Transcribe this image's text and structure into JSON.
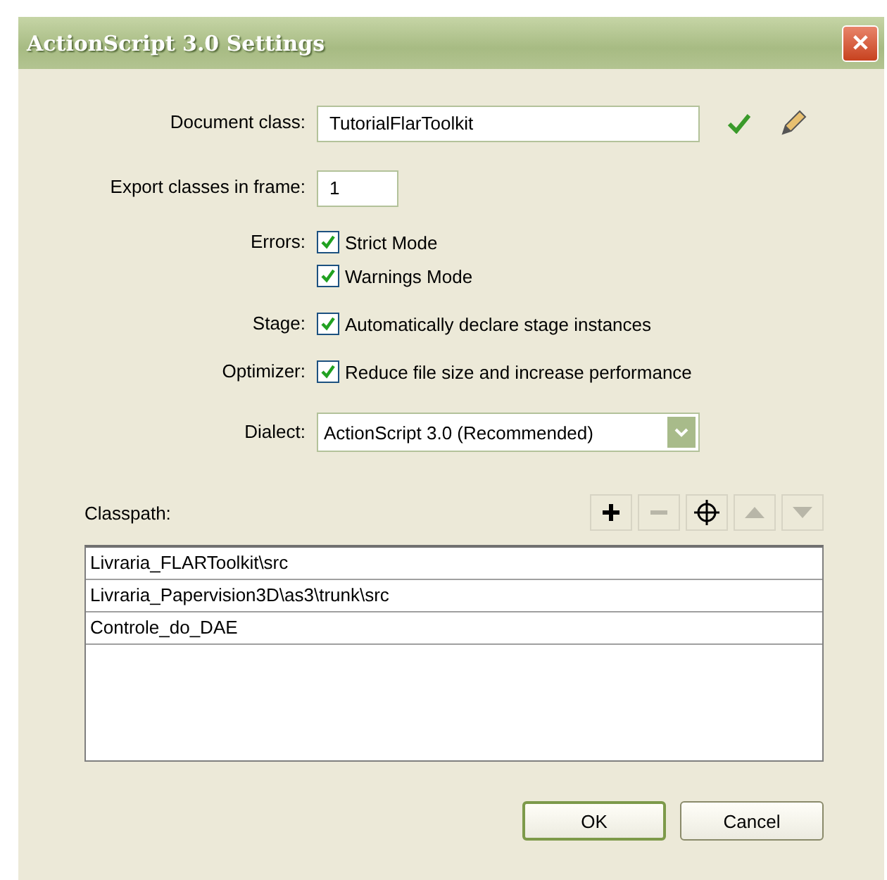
{
  "window": {
    "title": "ActionScript 3.0 Settings",
    "close": "✕"
  },
  "document_class": {
    "label": "Document class:",
    "value": "TutorialFlarToolkit"
  },
  "export_frame": {
    "label": "Export classes in frame:",
    "value": "1"
  },
  "options": [
    {
      "label": "Errors:",
      "checkboxes": [
        {
          "text": "Strict Mode",
          "checked": true
        },
        {
          "text": "Warnings Mode",
          "checked": true
        }
      ]
    },
    {
      "label": "Stage:",
      "checkboxes": [
        {
          "text": "Automatically declare stage instances",
          "checked": true
        }
      ]
    },
    {
      "label": "Optimizer:",
      "checkboxes": [
        {
          "text": "Reduce file size and increase performance",
          "checked": true
        }
      ]
    }
  ],
  "dialect": {
    "label": "Dialect:",
    "value": "ActionScript 3.0 (Recommended)"
  },
  "classpath": {
    "label": "Classpath:",
    "tools": [
      {
        "kind": "add",
        "disabled": false
      },
      {
        "kind": "remove",
        "disabled": true
      },
      {
        "kind": "target",
        "disabled": false
      },
      {
        "kind": "up",
        "disabled": true
      },
      {
        "kind": "down",
        "disabled": true
      }
    ],
    "paths": [
      "Livraria_FLARToolkit\\src",
      "Livraria_Papervision3D\\as3\\trunk\\src",
      "Controle_do_DAE"
    ]
  },
  "buttons": [
    {
      "label": "OK",
      "default": true
    },
    {
      "label": "Cancel",
      "default": false
    }
  ]
}
